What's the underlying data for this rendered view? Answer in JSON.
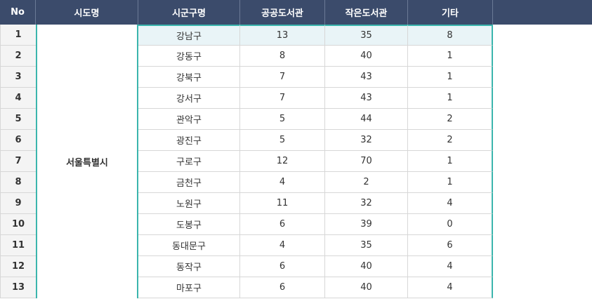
{
  "headers": [
    "No",
    "시도명",
    "시군구명",
    "공공도서관",
    "작은도서관",
    "기타"
  ],
  "sido": "서울특별시",
  "rows": [
    {
      "no": "1",
      "sigungu": "강남구",
      "public": "13",
      "small": "35",
      "other": "8"
    },
    {
      "no": "2",
      "sigungu": "강동구",
      "public": "8",
      "small": "40",
      "other": "1"
    },
    {
      "no": "3",
      "sigungu": "강북구",
      "public": "7",
      "small": "43",
      "other": "1"
    },
    {
      "no": "4",
      "sigungu": "강서구",
      "public": "7",
      "small": "43",
      "other": "1"
    },
    {
      "no": "5",
      "sigungu": "관악구",
      "public": "5",
      "small": "44",
      "other": "2"
    },
    {
      "no": "6",
      "sigungu": "광진구",
      "public": "5",
      "small": "32",
      "other": "2"
    },
    {
      "no": "7",
      "sigungu": "구로구",
      "public": "12",
      "small": "70",
      "other": "1"
    },
    {
      "no": "8",
      "sigungu": "금천구",
      "public": "4",
      "small": "2",
      "other": "1"
    },
    {
      "no": "9",
      "sigungu": "노원구",
      "public": "11",
      "small": "32",
      "other": "4"
    },
    {
      "no": "10",
      "sigungu": "도봉구",
      "public": "6",
      "small": "39",
      "other": "0"
    },
    {
      "no": "11",
      "sigungu": "동대문구",
      "public": "4",
      "small": "35",
      "other": "6"
    },
    {
      "no": "12",
      "sigungu": "동작구",
      "public": "6",
      "small": "40",
      "other": "4"
    },
    {
      "no": "13",
      "sigungu": "마포구",
      "public": "6",
      "small": "40",
      "other": "4"
    }
  ],
  "colors": {
    "header_bg": "#3b4b6b",
    "accent": "#3bb5ad",
    "highlight_row": "#e9f4f7"
  }
}
